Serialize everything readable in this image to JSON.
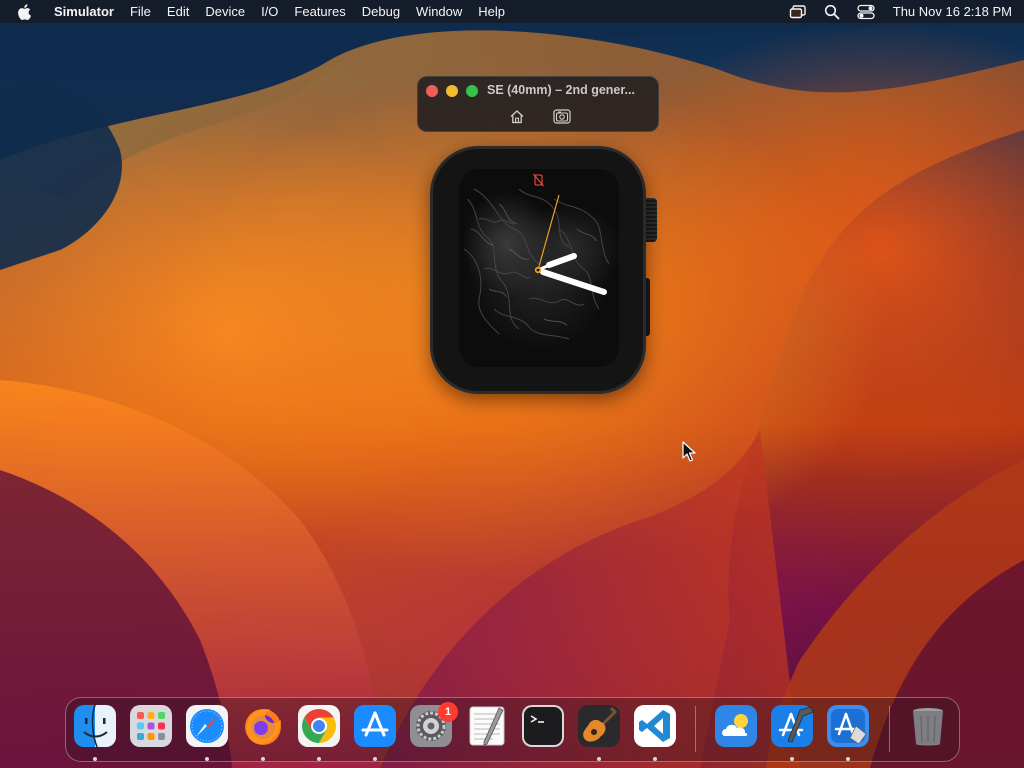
{
  "menubar": {
    "app_name": "Simulator",
    "items": [
      "File",
      "Edit",
      "Device",
      "I/O",
      "Features",
      "Debug",
      "Window",
      "Help"
    ],
    "clock": "Thu Nov 16  2:18 PM",
    "status_icons": [
      "screen-mirroring-icon",
      "spotlight-search-icon",
      "control-center-icon"
    ]
  },
  "simulator": {
    "title": "SE (40mm) – 2nd gener...",
    "toolbar_buttons": [
      "home-icon",
      "screenshot-camera-icon"
    ]
  },
  "watch": {
    "face": "analog clock face",
    "status_icon": "notification-disconnected-icon",
    "hour_hand_angle": 66,
    "minute_hand_angle": 115,
    "second_hand_angle": 16
  },
  "dock": {
    "apps": [
      {
        "name": "Finder",
        "icon": "finder-icon",
        "running": true
      },
      {
        "name": "Launchpad",
        "icon": "launchpad-icon",
        "running": false
      },
      {
        "name": "Safari",
        "icon": "safari-icon",
        "running": true
      },
      {
        "name": "Firefox",
        "icon": "firefox-icon",
        "running": true
      },
      {
        "name": "Google Chrome",
        "icon": "chrome-icon",
        "running": true
      },
      {
        "name": "App Store",
        "icon": "app-store-icon",
        "running": true
      },
      {
        "name": "System Settings",
        "icon": "system-settings-icon",
        "running": false,
        "badge": "1"
      },
      {
        "name": "TextEdit",
        "icon": "textedit-icon",
        "running": false
      },
      {
        "name": "Terminal",
        "icon": "terminal-icon",
        "running": false
      },
      {
        "name": "GarageBand",
        "icon": "garageband-icon",
        "running": true
      },
      {
        "name": "Visual Studio Code",
        "icon": "vscode-icon",
        "running": true
      },
      {
        "name": "Weather",
        "icon": "weather-icon",
        "running": false
      },
      {
        "name": "Xcode",
        "icon": "xcode-icon",
        "running": true
      },
      {
        "name": "Simulator",
        "icon": "simulator-icon",
        "running": true
      },
      {
        "name": "Trash",
        "icon": "trash-icon",
        "running": false
      }
    ],
    "badge_count": "1"
  },
  "colors": {
    "close": "#ee5f57",
    "minimize": "#f2bc2f",
    "zoom": "#38c149",
    "watch_second_hand": "#f0a020",
    "badge": "#ff3b30"
  }
}
